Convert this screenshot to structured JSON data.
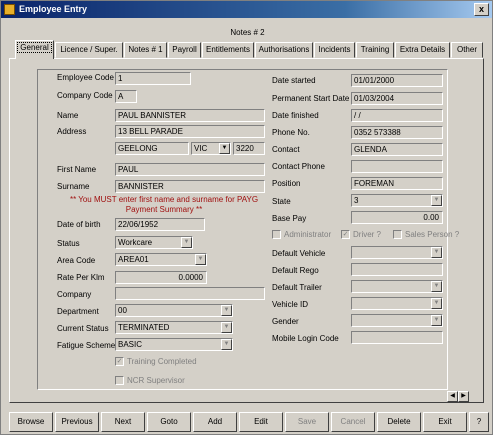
{
  "window": {
    "title": "Employee Entry",
    "close_label": "x"
  },
  "notes_header": "Notes # 2",
  "tabs": [
    "General",
    "Licence / Super.",
    "Notes # 1",
    "Payroll",
    "Entitlements",
    "Authorisations",
    "Incidents",
    "Training",
    "Extra Details",
    "Other"
  ],
  "left": {
    "employee_code_label": "Employee Code",
    "employee_code": "1",
    "company_code_label": "Company Code",
    "company_code": "A",
    "name_label": "Name",
    "name": "PAUL BANNISTER",
    "address_label": "Address",
    "address": "13 BELL PARADE",
    "suburb": "GEELONG",
    "state": "VIC",
    "postcode": "3220",
    "first_name_label": "First Name",
    "first_name": "PAUL",
    "surname_label": "Surname",
    "surname": "BANNISTER",
    "warning_line1": "** You MUST enter first name and surname for PAYG",
    "warning_line2": "Payment Summary **",
    "dob_label": "Date of birth",
    "dob": "22/06/1952",
    "status_label": "Status",
    "status": "Workcare",
    "area_code_label": "Area Code",
    "area_code": "AREA01",
    "rate_label": "Rate Per Klm",
    "rate": "0.0000",
    "company_label": "Company",
    "company": "",
    "department_label": "Department",
    "department": "00",
    "current_status_label": "Current Status",
    "current_status": "TERMINATED",
    "fatigue_label": "Fatigue Scheme",
    "fatigue": "BASIC",
    "training_completed_label": "Training Completed",
    "ncr_supervisor_label": "NCR Supervisor"
  },
  "right": {
    "date_started_label": "Date started",
    "date_started": "01/01/2000",
    "perm_start_label": "Permanent Start Date",
    "perm_start": "01/03/2004",
    "date_finished_label": "Date finished",
    "date_finished": " / /",
    "phone_label": "Phone No.",
    "phone": "0352 573388",
    "contact_label": "Contact",
    "contact": "GLENDA",
    "contact_phone_label": "Contact Phone",
    "contact_phone": "",
    "position_label": "Position",
    "position": "FOREMAN",
    "state_label": "State",
    "state": "3",
    "base_pay_label": "Base Pay",
    "base_pay": "0.00",
    "administrator_label": "Administrator",
    "driver_label": "Driver ?",
    "sales_person_label": "Sales Person ?",
    "default_vehicle_label": "Default Vehicle",
    "default_vehicle": "",
    "default_rego_label": "Default Rego",
    "default_rego": "",
    "default_trailer_label": "Default Trailer",
    "default_trailer": "",
    "vehicle_id_label": "Vehicle ID",
    "vehicle_id": "",
    "gender_label": "Gender",
    "gender": "",
    "mobile_login_label": "Mobile Login Code",
    "mobile_login": ""
  },
  "toolbar": [
    "Browse",
    "Previous",
    "Next",
    "Goto",
    "Add",
    "Edit",
    "Save",
    "Cancel",
    "Delete",
    "Exit",
    "?"
  ]
}
